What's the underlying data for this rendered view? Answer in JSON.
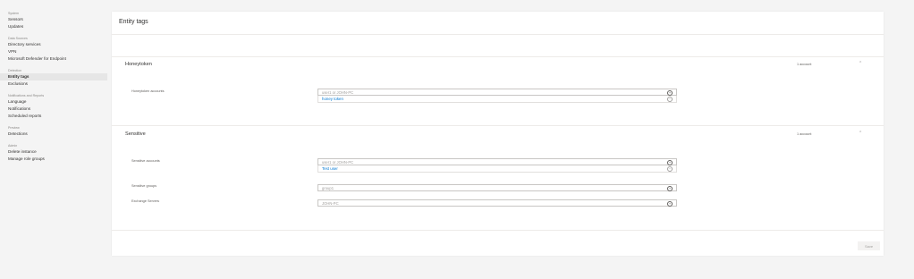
{
  "sidebar": {
    "sections": [
      {
        "heading": "System",
        "items": [
          "Sensors",
          "Updates"
        ]
      },
      {
        "heading": "Data Sources",
        "items": [
          "Directory services",
          "VPN",
          "Microsoft Defender for Endpoint"
        ]
      },
      {
        "heading": "Detection",
        "items": [
          "Entity tags",
          "Exclusions"
        ]
      },
      {
        "heading": "Notifications and Reports",
        "items": [
          "Language",
          "Notifications",
          "Scheduled reports"
        ]
      },
      {
        "heading": "Preview",
        "items": [
          "Detections"
        ]
      },
      {
        "heading": "Admin",
        "items": [
          "Delete instance",
          "Manage role groups"
        ]
      }
    ],
    "active_item": "Entity tags"
  },
  "page": {
    "title": "Entity tags",
    "save_label": "Save"
  },
  "honeytoken": {
    "title": "Honeytoken",
    "count": "1 account",
    "accounts_label": "Honeytoken accounts",
    "accounts_placeholder": "user1 or JOHN-PC",
    "accounts_tags": [
      "honey token"
    ]
  },
  "sensitive": {
    "title": "Sensitive",
    "count": "1 account",
    "accounts_label": "Sensitive accounts",
    "accounts_placeholder": "user1 or JOHN-PC",
    "accounts_tags": [
      "Test user"
    ],
    "groups_label": "Sensitive groups",
    "groups_placeholder": "group1",
    "exchange_label": "Exchange Servers",
    "exchange_placeholder": "JOHN-PC"
  },
  "icons": {
    "add": "plus-circle-icon",
    "remove": "minus-circle-icon",
    "collapse": "chevron-up-icon"
  }
}
